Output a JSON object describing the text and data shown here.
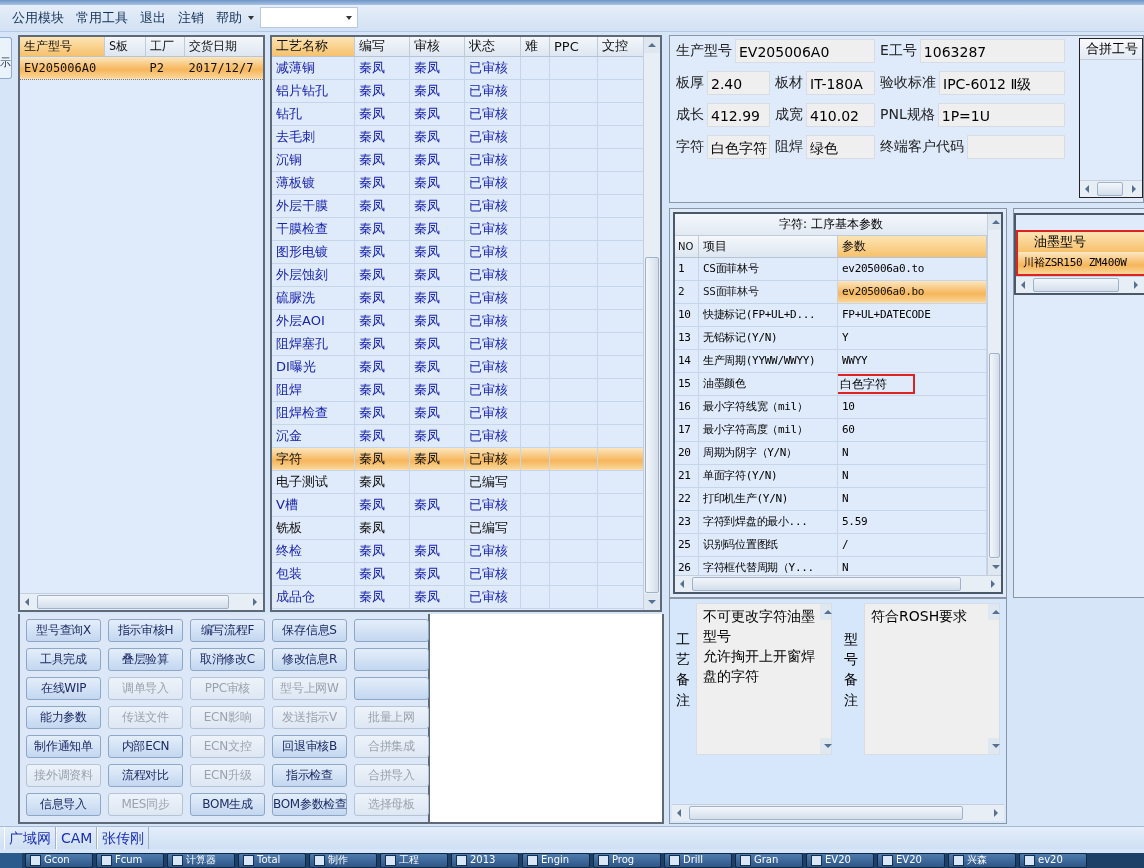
{
  "menu": [
    {
      "label": "公用模块"
    },
    {
      "label": "常用工具"
    },
    {
      "label": "退出"
    },
    {
      "label": "注销"
    },
    {
      "label": "帮助",
      "dropdown": true
    }
  ],
  "side_tab": "示",
  "orders": {
    "columns": [
      "生产型号",
      "S板",
      "工厂",
      "交货日期"
    ],
    "rows": [
      {
        "cells": [
          "EV205006A0",
          "",
          "P2",
          "2017/12/7"
        ],
        "selected": true
      }
    ]
  },
  "processes": {
    "columns": [
      "工艺名称",
      "编写",
      "审核",
      "状态",
      "难",
      "PPC",
      "文控"
    ],
    "rows": [
      {
        "name": "减薄铜",
        "writer": "秦凤",
        "reviewer": "秦凤",
        "status": "已审核",
        "kind": "reviewed",
        "selected": false
      },
      {
        "name": "铝片钻孔",
        "writer": "秦凤",
        "reviewer": "秦凤",
        "status": "已审核",
        "kind": "reviewed",
        "selected": false
      },
      {
        "name": "钻孔",
        "writer": "秦凤",
        "reviewer": "秦凤",
        "status": "已审核",
        "kind": "reviewed",
        "selected": false
      },
      {
        "name": "去毛刺",
        "writer": "秦凤",
        "reviewer": "秦凤",
        "status": "已审核",
        "kind": "reviewed",
        "selected": false
      },
      {
        "name": "沉铜",
        "writer": "秦凤",
        "reviewer": "秦凤",
        "status": "已审核",
        "kind": "reviewed",
        "selected": false
      },
      {
        "name": "薄板镀",
        "writer": "秦凤",
        "reviewer": "秦凤",
        "status": "已审核",
        "kind": "reviewed",
        "selected": false
      },
      {
        "name": "外层干膜",
        "writer": "秦凤",
        "reviewer": "秦凤",
        "status": "已审核",
        "kind": "reviewed",
        "selected": false
      },
      {
        "name": "干膜检查",
        "writer": "秦凤",
        "reviewer": "秦凤",
        "status": "已审核",
        "kind": "reviewed",
        "selected": false
      },
      {
        "name": "图形电镀",
        "writer": "秦凤",
        "reviewer": "秦凤",
        "status": "已审核",
        "kind": "reviewed",
        "selected": false
      },
      {
        "name": "外层蚀刻",
        "writer": "秦凤",
        "reviewer": "秦凤",
        "status": "已审核",
        "kind": "reviewed",
        "selected": false
      },
      {
        "name": "硫脲洗",
        "writer": "秦凤",
        "reviewer": "秦凤",
        "status": "已审核",
        "kind": "reviewed",
        "selected": false
      },
      {
        "name": "外层AOI",
        "writer": "秦凤",
        "reviewer": "秦凤",
        "status": "已审核",
        "kind": "reviewed",
        "selected": false
      },
      {
        "name": "阻焊塞孔",
        "writer": "秦凤",
        "reviewer": "秦凤",
        "status": "已审核",
        "kind": "reviewed",
        "selected": false
      },
      {
        "name": "DI曝光",
        "writer": "秦凤",
        "reviewer": "秦凤",
        "status": "已审核",
        "kind": "reviewed",
        "selected": false
      },
      {
        "name": "阻焊",
        "writer": "秦凤",
        "reviewer": "秦凤",
        "status": "已审核",
        "kind": "reviewed",
        "selected": false
      },
      {
        "name": "阻焊检查",
        "writer": "秦凤",
        "reviewer": "秦凤",
        "status": "已审核",
        "kind": "reviewed",
        "selected": false
      },
      {
        "name": "沉金",
        "writer": "秦凤",
        "reviewer": "秦凤",
        "status": "已审核",
        "kind": "reviewed",
        "selected": false
      },
      {
        "name": "字符",
        "writer": "秦凤",
        "reviewer": "秦凤",
        "status": "已审核",
        "kind": "reviewed",
        "selected": true
      },
      {
        "name": "电子测试",
        "writer": "秦凤",
        "status": "已编写",
        "kind": "written",
        "selected": false
      },
      {
        "name": "V槽",
        "writer": "秦凤",
        "reviewer": "秦凤",
        "status": "已审核",
        "kind": "reviewed",
        "selected": false
      },
      {
        "name": "铣板",
        "writer": "秦凤",
        "status": "已编写",
        "kind": "written",
        "selected": false
      },
      {
        "name": "终检",
        "writer": "秦凤",
        "reviewer": "秦凤",
        "status": "已审核",
        "kind": "reviewed",
        "selected": false
      },
      {
        "name": "包装",
        "writer": "秦凤",
        "reviewer": "秦凤",
        "status": "已审核",
        "kind": "reviewed",
        "selected": false
      },
      {
        "name": "成品仓",
        "writer": "秦凤",
        "reviewer": "秦凤",
        "status": "已审核",
        "kind": "reviewed",
        "selected": false
      }
    ]
  },
  "buttons": [
    {
      "label": "型号查询X",
      "disabled": false
    },
    {
      "label": "指示审核H",
      "disabled": false
    },
    {
      "label": "编写流程F",
      "disabled": false
    },
    {
      "label": "保存信息S",
      "disabled": false
    },
    {
      "disabled": false
    },
    {
      "label": "工具完成",
      "disabled": false
    },
    {
      "label": "叠层验算",
      "disabled": false
    },
    {
      "label": "取消修改C",
      "disabled": false
    },
    {
      "label": "修改信息R",
      "disabled": false
    },
    {
      "disabled": false
    },
    {
      "label": "在线WIP",
      "disabled": false
    },
    {
      "label": "调单导入",
      "disabled": true
    },
    {
      "label": "PPC审核",
      "disabled": true
    },
    {
      "label": "型号上网W",
      "disabled": true
    },
    {
      "disabled": false
    },
    {
      "label": "能力参数",
      "disabled": false
    },
    {
      "label": "传送文件",
      "disabled": true
    },
    {
      "label": "ECN影响",
      "disabled": true
    },
    {
      "label": "发送指示V",
      "disabled": true
    },
    {
      "label": "批量上网",
      "disabled": true
    },
    {
      "label": "制作通知单",
      "disabled": false
    },
    {
      "label": "内部ECN",
      "disabled": false
    },
    {
      "label": "ECN文控",
      "disabled": true
    },
    {
      "label": "回退审核B",
      "disabled": false
    },
    {
      "label": "合拼集成",
      "disabled": true
    },
    {
      "label": "接外调资料",
      "disabled": true
    },
    {
      "label": "流程对比",
      "disabled": false
    },
    {
      "label": "ECN升级",
      "disabled": true
    },
    {
      "label": "指示检查",
      "disabled": false
    },
    {
      "label": "合拼导入",
      "disabled": true
    },
    {
      "label": "信息导入",
      "disabled": false
    },
    {
      "label": "MES同步",
      "disabled": true
    },
    {
      "label": "BOM生成",
      "disabled": false
    },
    {
      "label": "BOM参数检查",
      "disabled": false
    },
    {
      "label": "选择母板",
      "disabled": true
    }
  ],
  "info": {
    "rows": [
      [
        {
          "label": "生产型号",
          "value": "EV205006A0"
        },
        "",
        {
          "label": "E工号",
          "value": "1063287"
        }
      ],
      [
        {
          "label": "板厚",
          "value": "2.40"
        },
        {
          "label": "板材",
          "value": "IT-180A"
        },
        {
          "label": "验收标准",
          "value": "IPC-6012 Ⅱ级"
        }
      ],
      [
        {
          "label": "成长",
          "value": "412.99"
        },
        {
          "label": "成宽",
          "value": "410.02"
        },
        {
          "label": "PNL规格",
          "value": "1P=1U"
        }
      ],
      [
        {
          "label": "字符",
          "value": "白色字符"
        },
        {
          "label": "阻焊",
          "value": "绿色"
        },
        {
          "label": "终端客户代码"
        }
      ]
    ],
    "merge_list": {
      "columns": [
        "合拼工号"
      ]
    }
  },
  "params": {
    "title": "字符: 工序基本参数",
    "columns": [
      "NO",
      "项目",
      "参数"
    ],
    "rows": [
      {
        "no": "1",
        "item": "CS面菲林号",
        "value": "ev205006a0.to",
        "selected": false,
        "highlighted": false
      },
      {
        "no": "2",
        "item": "SS面菲林号",
        "value": "ev205006a0.bo",
        "selected": true,
        "highlighted": false
      },
      {
        "no": "10",
        "item": "快捷标记(FP+UL+D...",
        "value": "FP+UL+DATECODE",
        "selected": false,
        "highlighted": false
      },
      {
        "no": "13",
        "item": "无铅标记(Y/N)",
        "value": "Y",
        "selected": false,
        "highlighted": false
      },
      {
        "no": "14",
        "item": "生产周期(YYWW/WWYY)",
        "value": "WWYY",
        "selected": false,
        "highlighted": false
      },
      {
        "no": "15",
        "item": "油墨颜色",
        "value": "白色字符",
        "selected": false,
        "highlighted": true
      },
      {
        "no": "16",
        "item": "最小字符线宽（mil）",
        "value": "10",
        "selected": false,
        "highlighted": false
      },
      {
        "no": "17",
        "item": "最小字符高度（mil）",
        "value": "60",
        "selected": false,
        "highlighted": false
      },
      {
        "no": "20",
        "item": "周期为阴字（Y/N）",
        "value": "N",
        "selected": false,
        "highlighted": false
      },
      {
        "no": "21",
        "item": "单面字符(Y/N)",
        "value": "N",
        "selected": false,
        "highlighted": false
      },
      {
        "no": "22",
        "item": "打印机生产(Y/N)",
        "value": "N",
        "selected": false,
        "highlighted": false
      },
      {
        "no": "23",
        "item": "字符到焊盘的最小...",
        "value": "5.59",
        "selected": false,
        "highlighted": false
      },
      {
        "no": "25",
        "item": "识别码位置图纸",
        "value": "/",
        "selected": false,
        "highlighted": false
      },
      {
        "no": "26",
        "item": "字符框代替周期（Y...",
        "value": "N",
        "selected": false,
        "highlighted": false
      }
    ]
  },
  "ink": {
    "columns": [
      "油墨型号"
    ],
    "highlighted": true,
    "rows": [
      {
        "cells": [
          "川裕ZSR150 ZM400W"
        ],
        "selected": true
      }
    ]
  },
  "remarks": [
    {
      "label": "工艺备注",
      "lines": [
        "不可更改字符油墨型号",
        "允许掏开上开窗焊盘的字符"
      ]
    },
    {
      "label": "型号备注",
      "lines": [
        "符合ROSH要求"
      ]
    }
  ],
  "status_tabs": [
    "广域网",
    "CAM",
    "张传刚"
  ],
  "taskbar": [
    "Gcon",
    "Fcum",
    "计算器",
    "Total",
    "制作",
    "工程",
    "2013",
    "Engin",
    "Prog",
    "Drill",
    "Gran",
    "EV20",
    "EV20",
    "兴森",
    "ev20"
  ]
}
